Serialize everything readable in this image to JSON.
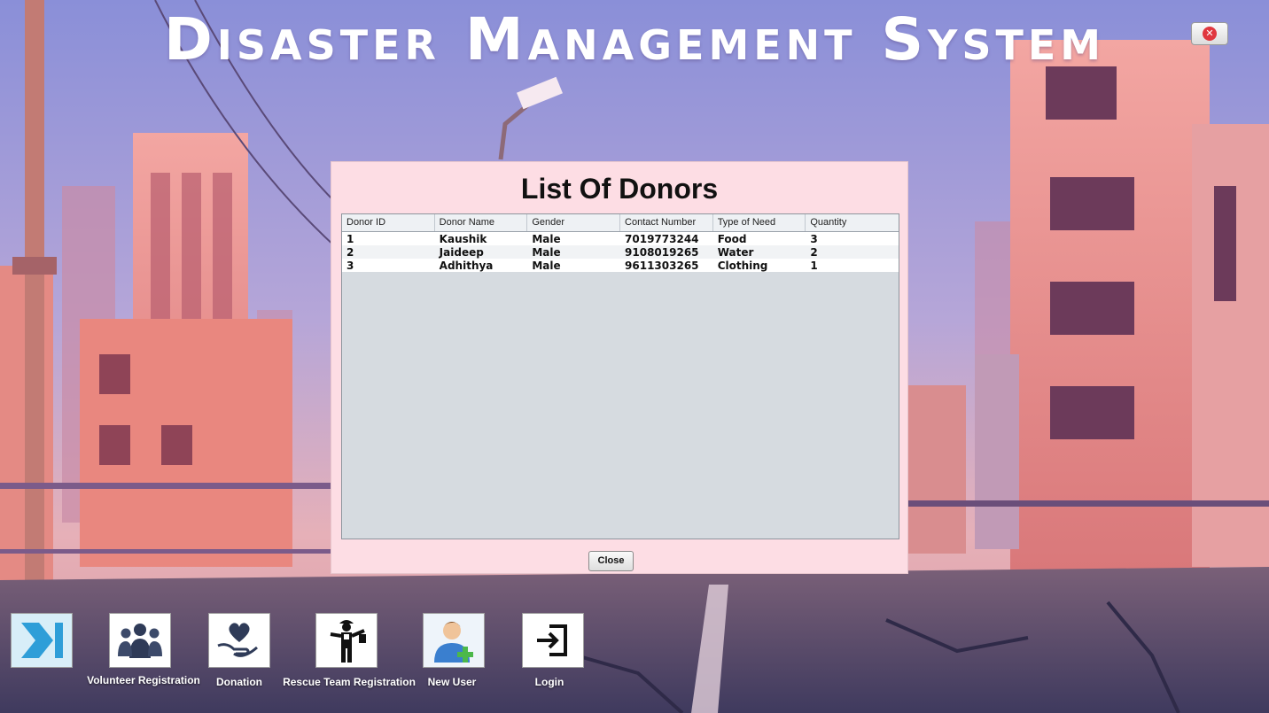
{
  "app": {
    "title": "Disaster Management System",
    "exit_icon": "close-circle-icon",
    "accent": "#e0373f"
  },
  "dialog": {
    "title": "List Of Donors",
    "columns": [
      "Donor ID",
      "Donor Name",
      "Gender",
      "Contact Number",
      "Type of Need",
      "Quantity"
    ],
    "rows": [
      [
        "1",
        "Kaushik",
        "Male",
        "7019773244",
        "Food",
        "3"
      ],
      [
        "2",
        "Jaideep",
        "Male",
        "9108019265",
        "Water",
        "2"
      ],
      [
        "3",
        "Adhithya",
        "Male",
        "9611303265",
        "Clothing",
        "1"
      ]
    ],
    "close_label": "Close"
  },
  "toolbar": {
    "items": [
      {
        "label": "",
        "icon": "skip-forward-icon"
      },
      {
        "label": "Volunteer Registration",
        "icon": "group-icon"
      },
      {
        "label": "Donation",
        "icon": "heart-hand-icon"
      },
      {
        "label": "Rescue Team Registration",
        "icon": "rescuer-icon"
      },
      {
        "label": "New User",
        "icon": "add-user-icon"
      },
      {
        "label": "Login",
        "icon": "login-icon"
      }
    ]
  }
}
